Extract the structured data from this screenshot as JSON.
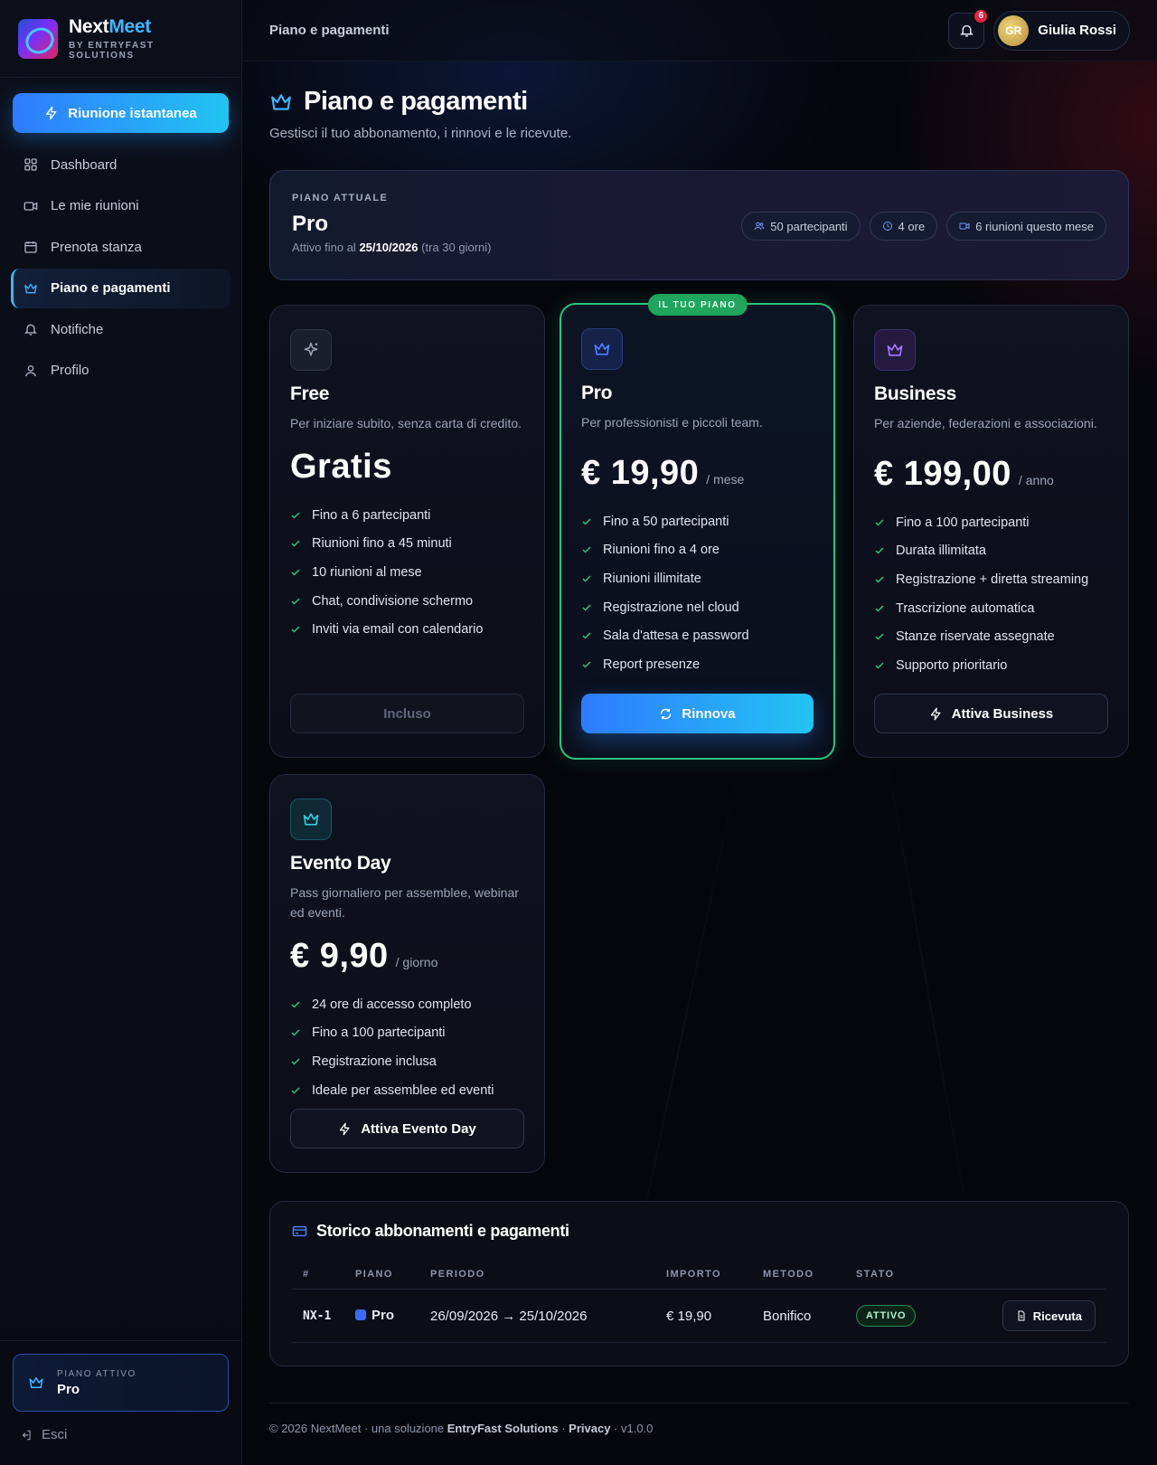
{
  "brand": {
    "name_a": "Next",
    "name_b": "Meet",
    "subtitle": "BY ENTRYFAST SOLUTIONS"
  },
  "sidebar": {
    "instant_label": "Riunione istantanea",
    "items": [
      {
        "label": "Dashboard",
        "icon": "grid-icon"
      },
      {
        "label": "Le mie riunioni",
        "icon": "video-icon"
      },
      {
        "label": "Prenota stanza",
        "icon": "calendar-icon"
      },
      {
        "label": "Piano e pagamenti",
        "icon": "crown-icon",
        "active": true
      },
      {
        "label": "Notifiche",
        "icon": "bell-icon"
      },
      {
        "label": "Profilo",
        "icon": "user-icon"
      }
    ],
    "plan_label": "PIANO ATTIVO",
    "plan_value": "Pro",
    "logout_label": "Esci"
  },
  "topbar": {
    "title": "Piano e pagamenti",
    "notifications_count": "6",
    "user_initials": "GR",
    "user_name": "Giulia Rossi"
  },
  "page": {
    "title": "Piano e pagamenti",
    "subtitle": "Gestisci il tuo abbonamento, i rinnovi e le ricevute."
  },
  "current_plan": {
    "label": "PIANO ATTUALE",
    "name": "Pro",
    "until_prefix": "Attivo fino al",
    "until_date": "25/10/2026",
    "until_suffix": "(tra 30 giorni)",
    "chips": [
      "50 partecipanti",
      "4 ore",
      "6 riunioni questo mese"
    ]
  },
  "plans": [
    {
      "name": "Free",
      "desc": "Per iniziare subito, senza carta di credito.",
      "price": "Gratis",
      "per": "",
      "features": [
        "Fino a 6 partecipanti",
        "Riunioni fino a 45 minuti",
        "10 riunioni al mese",
        "Chat, condivisione schermo",
        "Inviti via email con calendario"
      ],
      "button": "Incluso",
      "icon_color": "#9aa3b8"
    },
    {
      "name": "Pro",
      "tag": "IL TUO PIANO",
      "desc": "Per professionisti e piccoli team.",
      "price": "€ 19,90",
      "per": "/ mese",
      "features": [
        "Fino a 50 partecipanti",
        "Riunioni fino a 4 ore",
        "Riunioni illimitate",
        "Registrazione nel cloud",
        "Sala d'attesa e password",
        "Report presenze"
      ],
      "button": "Rinnova",
      "icon_color": "#4f7dff"
    },
    {
      "name": "Business",
      "desc": "Per aziende, federazioni e associazioni.",
      "price": "€ 199,00",
      "per": "/ anno",
      "features": [
        "Fino a 100 partecipanti",
        "Durata illimitata",
        "Registrazione + diretta streaming",
        "Trascrizione automatica",
        "Stanze riservate assegnate",
        "Supporto prioritario"
      ],
      "button": "Attiva Business",
      "icon_color": "#a678ff"
    },
    {
      "name": "Evento Day",
      "desc": "Pass giornaliero per assemblee, webinar ed eventi.",
      "price": "€ 9,90",
      "per": "/ giorno",
      "features": [
        "24 ore di accesso completo",
        "Fino a 100 partecipanti",
        "Registrazione inclusa",
        "Ideale per assemblee ed eventi"
      ],
      "button": "Attiva Evento Day",
      "icon_color": "#2fd0e0"
    }
  ],
  "history": {
    "title": "Storico abbonamenti e pagamenti",
    "columns": [
      "#",
      "PIANO",
      "PERIODO",
      "IMPORTO",
      "METODO",
      "STATO"
    ],
    "rows": [
      {
        "id": "NX-1",
        "plan": "Pro",
        "period": "26/09/2026 → 25/10/2026",
        "amount": "€ 19,90",
        "method": "Bonifico",
        "status": "ATTIVO",
        "action": "Ricevuta"
      }
    ]
  },
  "footer": {
    "prefix": "© 2026 NextMeet · una soluzione",
    "company": "EntryFast Solutions",
    "sep": "·",
    "privacy": "Privacy",
    "version": "· v1.0.0"
  },
  "colors": {
    "accent": "#2f7bff",
    "accent2": "#22c4f2",
    "success": "#2ec27e",
    "danger": "#e5233f"
  }
}
